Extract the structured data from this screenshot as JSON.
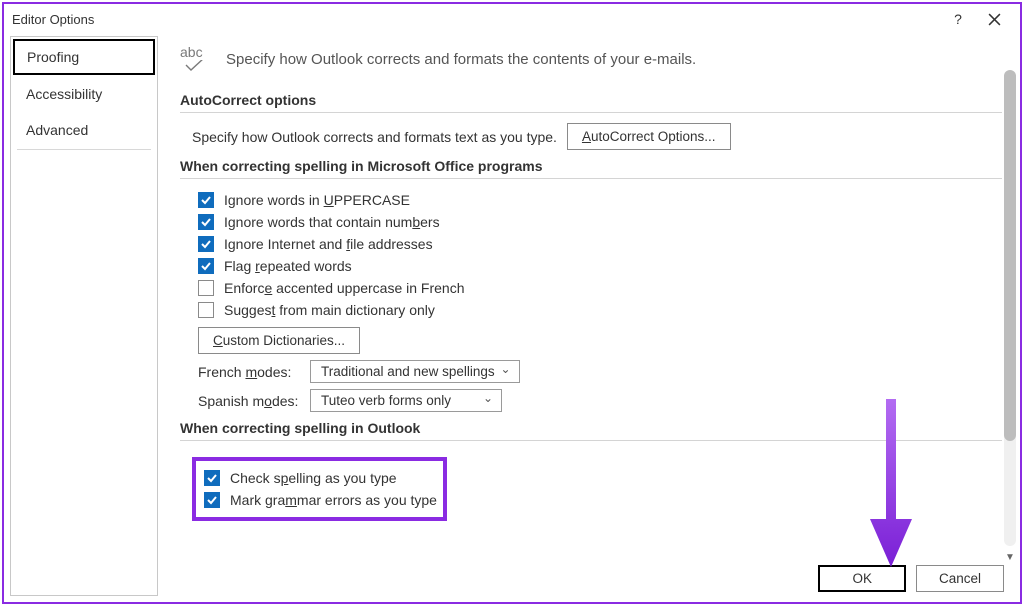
{
  "window": {
    "title": "Editor Options"
  },
  "sidebar": {
    "items": [
      {
        "label": "Proofing"
      },
      {
        "label": "Accessibility"
      },
      {
        "label": "Advanced"
      }
    ]
  },
  "intro": {
    "text": "Specify how Outlook corrects and formats the contents of your e-mails."
  },
  "sections": {
    "autocorrect": {
      "header": "AutoCorrect options",
      "desc": "Specify how Outlook corrects and formats text as you type.",
      "button": "AutoCorrect Options..."
    },
    "office_spelling": {
      "header": "When correcting spelling in Microsoft Office programs",
      "checks": [
        {
          "label_pre": "Ignore words in ",
          "label_u": "U",
          "label_post": "PPERCASE",
          "checked": true
        },
        {
          "label_pre": "Ignore words that contain num",
          "label_u": "b",
          "label_post": "ers",
          "checked": true
        },
        {
          "label_pre": "Ignore Internet and ",
          "label_u": "f",
          "label_post": "ile addresses",
          "checked": true
        },
        {
          "label_pre": "Flag ",
          "label_u": "r",
          "label_post": "epeated words",
          "checked": true
        },
        {
          "label_pre": "Enforc",
          "label_u": "e",
          "label_post": " accented uppercase in French",
          "checked": false
        },
        {
          "label_pre": "Sugges",
          "label_u": "t",
          "label_post": " from main dictionary only",
          "checked": false
        }
      ],
      "custom_dict_btn": "Custom Dictionaries...",
      "french_label": "French modes:",
      "french_value": "Traditional and new spellings",
      "spanish_label": "Spanish modes:",
      "spanish_value": "Tuteo verb forms only"
    },
    "outlook_spelling": {
      "header": "When correcting spelling in Outlook",
      "checks": [
        {
          "label_pre": "Check s",
          "label_u": "p",
          "label_post": "elling as you type",
          "checked": true
        },
        {
          "label_pre": "Mark gra",
          "label_u": "m",
          "label_post": "mar errors as you type",
          "checked": true
        }
      ]
    }
  },
  "footer": {
    "ok": "OK",
    "cancel": "Cancel"
  }
}
